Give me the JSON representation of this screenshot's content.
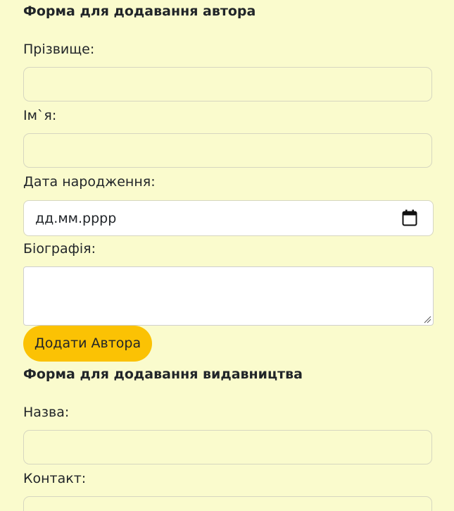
{
  "author_form": {
    "title": "Форма для додавання автора",
    "surname_label": "Прізвище:",
    "name_label": "Ім`я:",
    "birthdate_label": "Дата народження:",
    "birthdate_placeholder": "дд.мм.рррр",
    "biography_label": "Біографія:",
    "submit_label": "Додати Автора"
  },
  "publisher_form": {
    "title": "Форма для додавання видавництва",
    "name_label": "Назва:",
    "contact_label": "Контакт:"
  },
  "colors": {
    "background": "#fafbcd",
    "button": "#fbc204",
    "text": "#212529"
  }
}
